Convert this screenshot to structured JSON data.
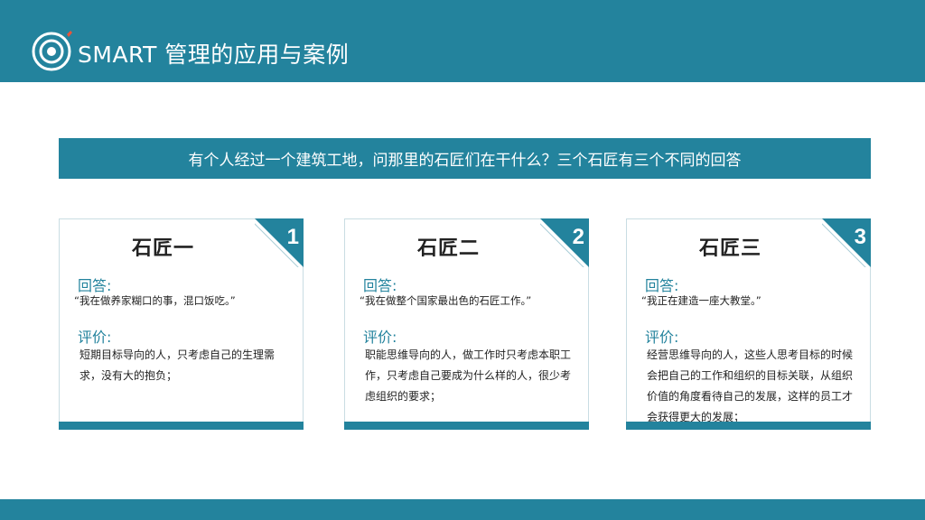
{
  "header": {
    "title": "SMART 管理的应用与案例",
    "logo_icon": "target-icon"
  },
  "banner": {
    "text": "有个人经过一个建筑工地，问那里的石匠们在干什么？三个石匠有三个不同的回答"
  },
  "cards": [
    {
      "number": "1",
      "title": "石匠一",
      "answer_label": "回答:",
      "answer": "“我在做养家糊口的事，混口饭吃。”",
      "review_label": "评价:",
      "review": "短期目标导向的人，只考虑自己的生理需求，没有大的抱负；"
    },
    {
      "number": "2",
      "title": "石匠二",
      "answer_label": "回答:",
      "answer": "“我在做整个国家最出色的石匠工作。”",
      "review_label": "评价:",
      "review": "职能思维导向的人，做工作时只考虑本职工作，只考虑自己要成为什么样的人，很少考虑组织的要求；"
    },
    {
      "number": "3",
      "title": "石匠三",
      "answer_label": "回答:",
      "answer": "“我正在建造一座大教堂。”",
      "review_label": "评价:",
      "review": "经营思维导向的人，这些人思考目标的时候会把自己的工作和组织的目标关联，从组织价值的角度看待自己的发展，这样的员工才会获得更大的发展；"
    }
  ],
  "colors": {
    "accent": "#23839d",
    "logo_dot": "#e8543a"
  }
}
